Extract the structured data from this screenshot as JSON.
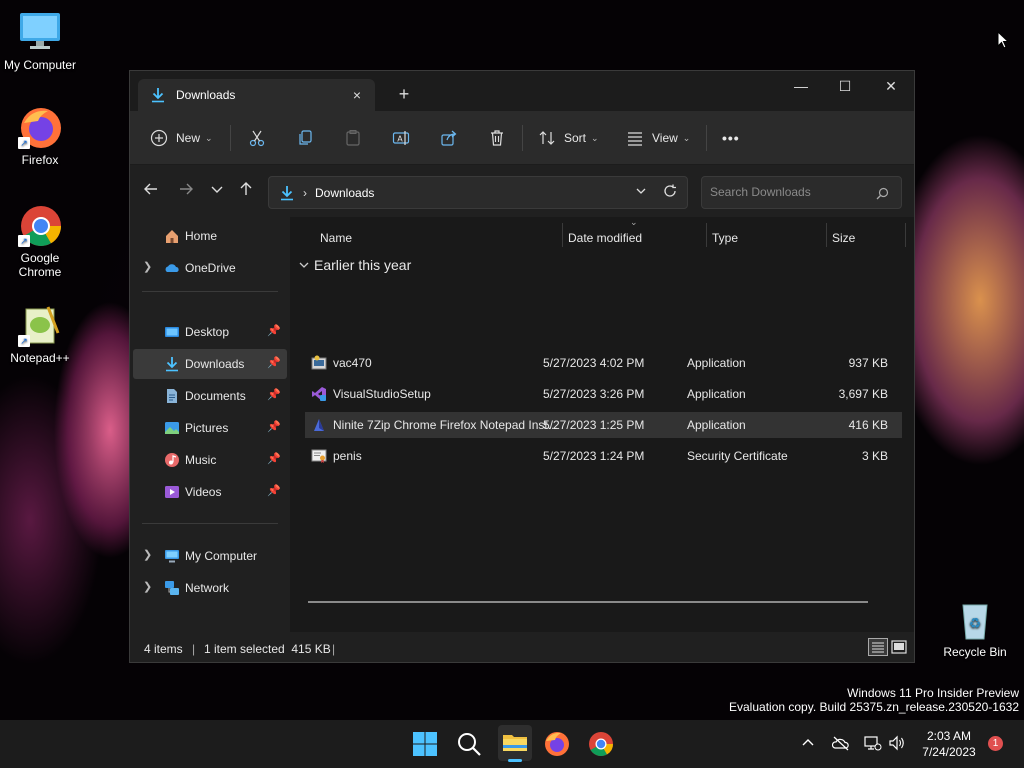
{
  "desktop": {
    "icons": [
      {
        "label": "My Computer",
        "icon": "monitor-icon"
      },
      {
        "label": "Firefox",
        "icon": "firefox-icon"
      },
      {
        "label": "Google Chrome",
        "icon": "chrome-icon"
      },
      {
        "label": "Notepad++",
        "icon": "notepadpp-icon"
      },
      {
        "label": "Recycle Bin",
        "icon": "recycle-bin-icon"
      }
    ],
    "watermark": {
      "line1": "Windows 11 Pro Insider Preview",
      "line2": "Evaluation copy. Build 25375.zn_release.230520-1632"
    }
  },
  "window": {
    "tab_title": "Downloads",
    "tab_close": "×",
    "new_tab": "+",
    "controls": {
      "minimize": "—",
      "maximize": "☐",
      "close": "✕"
    },
    "toolbar": {
      "new_label": "New",
      "sort_label": "Sort",
      "view_label": "View",
      "more": "•••"
    },
    "address": {
      "crumb_sep": "›",
      "path": "Downloads",
      "search_placeholder": "Search Downloads"
    },
    "sidebar": {
      "home": "Home",
      "onedrive": "OneDrive",
      "pinned": [
        {
          "label": "Desktop",
          "icon": "desktop-folder-icon"
        },
        {
          "label": "Downloads",
          "icon": "downloads-folder-icon",
          "selected": true
        },
        {
          "label": "Documents",
          "icon": "documents-folder-icon"
        },
        {
          "label": "Pictures",
          "icon": "pictures-folder-icon"
        },
        {
          "label": "Music",
          "icon": "music-folder-icon"
        },
        {
          "label": "Videos",
          "icon": "videos-folder-icon"
        }
      ],
      "my_computer": "My Computer",
      "network": "Network"
    },
    "columns": {
      "name": "Name",
      "date": "Date modified",
      "type": "Type",
      "size": "Size"
    },
    "group_label": "Earlier this year",
    "files": [
      {
        "name": "vac470",
        "date": "5/27/2023 4:02 PM",
        "type": "Application",
        "size": "937 KB",
        "icon": "installer-icon"
      },
      {
        "name": "VisualStudioSetup",
        "date": "5/27/2023 3:26 PM",
        "type": "Application",
        "size": "3,697 KB",
        "icon": "visual-studio-icon"
      },
      {
        "name": "Ninite 7Zip Chrome Firefox Notepad Inst...",
        "date": "5/27/2023 1:25 PM",
        "type": "Application",
        "size": "416 KB",
        "icon": "ninite-icon",
        "selected": true
      },
      {
        "name": "penis",
        "date": "5/27/2023 1:24 PM",
        "type": "Security Certificate",
        "size": "3 KB",
        "icon": "certificate-icon"
      }
    ],
    "status": {
      "items": "4 items",
      "sep": "|",
      "selected": "1 item selected  415 KB",
      "sep2": "|"
    }
  },
  "taskbar": {
    "time": "2:03 AM",
    "date": "7/24/2023",
    "notification_count": "1"
  },
  "colors": {
    "accent": "#4cc2ff",
    "window_bg": "#202020",
    "toolbar_bg": "#2b2b2b",
    "selection": "#333333",
    "folder_yellow": "#f0c040"
  }
}
